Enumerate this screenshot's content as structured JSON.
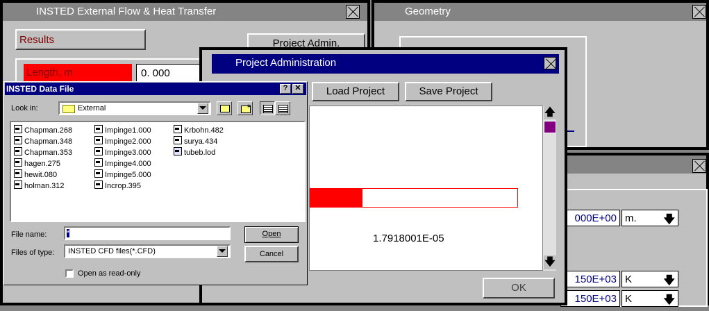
{
  "main_window": {
    "title": "INSTED External Flow & Heat Transfer",
    "results_label": "Results",
    "project_admin_button": "Project Admin.",
    "length_label": "Length, m",
    "length_value": "0. 000"
  },
  "geometry_window": {
    "title": "Geometry"
  },
  "right_panel": {
    "rows": [
      {
        "value": "000E+00",
        "unit": "m."
      },
      {
        "value": "150E+03",
        "unit": "K"
      },
      {
        "value": "150E+03",
        "unit": "K"
      }
    ]
  },
  "project_admin": {
    "title": "Project Administration",
    "load_button": "Load Project",
    "save_button": "Save Project",
    "progress_fraction": 0.25,
    "progress_value": "1.7918001E-05",
    "ok_button": "OK"
  },
  "file_dialog": {
    "title": "INSTED Data File",
    "help_button": "?",
    "look_in_label": "Look in:",
    "look_in_value": "External",
    "files": [
      "Chapman.268",
      "Chapman.348",
      "Chapman.353",
      "hagen.275",
      "hewit.080",
      "holman.312",
      "Impinge1.000",
      "Impinge2.000",
      "Impinge3.000",
      "Impinge4.000",
      "Impinge5.000",
      "Incrop.395",
      "Krbohn.482",
      "surya.434",
      "tubeb.lod"
    ],
    "file_name_label": "File name:",
    "file_name_value": "*",
    "files_of_type_label": "Files of type:",
    "files_of_type_value": "INSTED CFD files(*.CFD)",
    "open_button": "Open",
    "cancel_button": "Cancel",
    "readonly_label": "Open as read-only"
  },
  "colors": {
    "navy": "#000080",
    "red": "#ff0000",
    "gray": "#c0c0c0"
  }
}
